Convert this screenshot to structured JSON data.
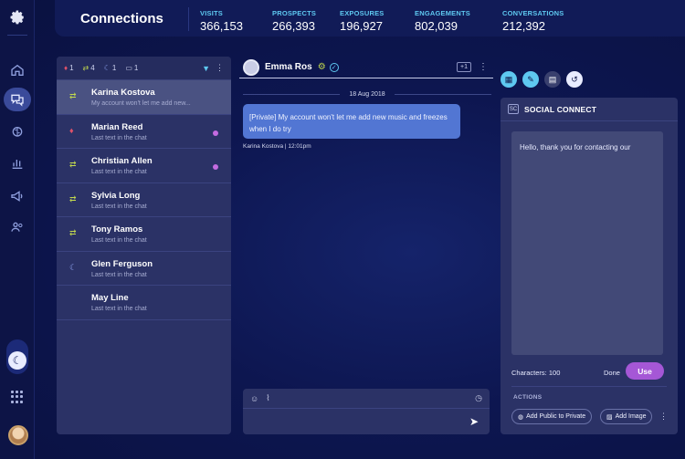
{
  "header": {
    "title": "Connections",
    "stats": [
      {
        "label": "VISITS",
        "value": "366,153"
      },
      {
        "label": "PROSPECTS",
        "value": "266,393"
      },
      {
        "label": "EXPOSURES",
        "value": "196,927"
      },
      {
        "label": "ENGAGEMENTS",
        "value": "802,039"
      },
      {
        "label": "CONVERSATIONS",
        "value": "212,392"
      }
    ]
  },
  "sidebar": {
    "icons": [
      "gear-icon",
      "home-icon",
      "chat-icon",
      "brain-icon",
      "bar-chart-icon",
      "megaphone-icon",
      "users-icon",
      "moon-icon",
      "apps-grid-icon",
      "avatar"
    ]
  },
  "filters": {
    "counts": [
      "1",
      "4",
      "1",
      "1"
    ]
  },
  "chats": [
    {
      "name": "Karina Kostova",
      "sub": "My account won't let me add new...",
      "icon": "⇄",
      "color": "#c2d94e",
      "selected": true,
      "unread": false
    },
    {
      "name": "Marian Reed",
      "sub": "Last text in the chat",
      "icon": "♦",
      "color": "#e0526a",
      "selected": false,
      "unread": true
    },
    {
      "name": "Christian Allen",
      "sub": "Last text in the chat",
      "icon": "⇄",
      "color": "#c2d94e",
      "selected": false,
      "unread": true
    },
    {
      "name": "Sylvia Long",
      "sub": "Last text in the chat",
      "icon": "⇄",
      "color": "#c2d94e",
      "selected": false,
      "unread": false
    },
    {
      "name": "Tony Ramos",
      "sub": "Last text in the chat",
      "icon": "⇄",
      "color": "#c2d94e",
      "selected": false,
      "unread": false
    },
    {
      "name": "Glen Ferguson",
      "sub": "Last text in the chat",
      "icon": "☾",
      "color": "#8ea3f0",
      "selected": false,
      "unread": false
    },
    {
      "name": "May Line",
      "sub": "Last text in the chat",
      "icon": "",
      "color": "#8ea3f0",
      "selected": false,
      "unread": false
    }
  ],
  "conversation": {
    "contact": "Emma Ros",
    "plus": "+1",
    "date": "18 Aug 2018",
    "message": "[Private] My account won't let me add new music and freezes when I do try",
    "meta": "Karina Kostova  |  12:01pm"
  },
  "panel": {
    "badge": "SC",
    "title": "SOCIAL CONNECT",
    "draft": "Hello, thank you for contacting our",
    "characters": "Characters: 100",
    "done": "Done",
    "use": "Use",
    "actions_label": "ACTIONS",
    "action_private": "Add Public to Private",
    "action_image": "Add Image"
  }
}
